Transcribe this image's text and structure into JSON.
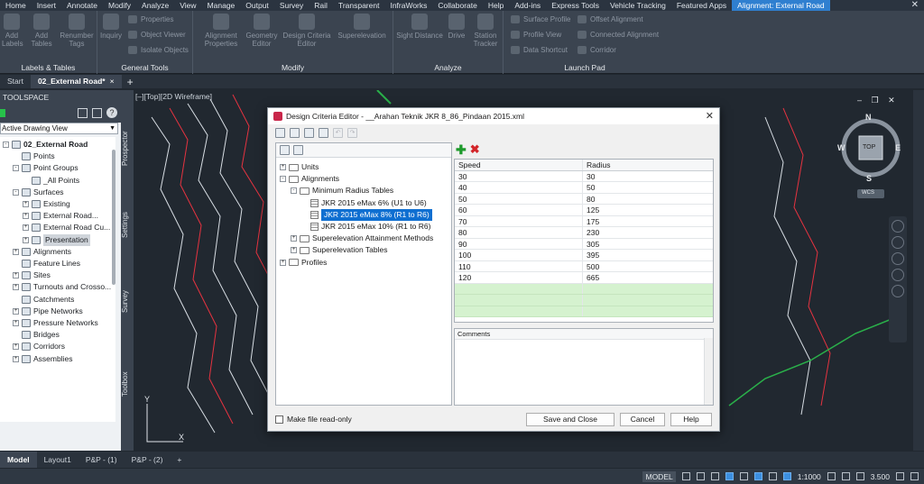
{
  "ribbon_tabs": [
    "Home",
    "Insert",
    "Annotate",
    "Modify",
    "Analyze",
    "View",
    "Manage",
    "Output",
    "Survey",
    "Rail",
    "Transparent",
    "InfraWorks",
    "Collaborate",
    "Help",
    "Add-ins",
    "Express Tools",
    "Vehicle Tracking",
    "Featured Apps",
    "Alignment: External Road"
  ],
  "ribbon": {
    "labels_tables": {
      "title": "Labels & Tables",
      "add_labels": "Add Labels",
      "add_tables": "Add Tables",
      "renumber_tags": "Renumber Tags"
    },
    "general_tools": {
      "title": "General Tools",
      "inquiry": "Inquiry",
      "properties": "Properties",
      "object_viewer": "Object Viewer",
      "isolate_objects": "Isolate Objects"
    },
    "modify": {
      "title": "Modify",
      "alignment_properties": "Alignment Properties",
      "geometry_editor": "Geometry Editor",
      "design_criteria_editor": "Design Criteria Editor",
      "superelevation": "Superelevation"
    },
    "analyze": {
      "title": "Analyze",
      "sight_distance": "Sight Distance",
      "drive": "Drive",
      "station_tracker": "Station Tracker"
    },
    "launch_pad": {
      "title": "Launch Pad",
      "surface_profile": "Surface Profile",
      "profile_view": "Profile View",
      "data_shortcut": "Data Shortcut",
      "offset_alignment": "Offset Alignment",
      "connected_alignment": "Connected Alignment",
      "corridor": "Corridor"
    }
  },
  "doc_tabs": {
    "start": "Start",
    "active": "02_External Road*",
    "close": "×",
    "plus": "+"
  },
  "toolspace": {
    "title": "TOOLSPACE",
    "view": "Active Drawing View",
    "tree": [
      {
        "label": "02_External Road",
        "level": 0,
        "exp": "-",
        "bold": true
      },
      {
        "label": "Points",
        "level": 1,
        "exp": ""
      },
      {
        "label": "Point Groups",
        "level": 1,
        "exp": "-"
      },
      {
        "label": "_All Points",
        "level": 2,
        "exp": ""
      },
      {
        "label": "Surfaces",
        "level": 1,
        "exp": "-"
      },
      {
        "label": "Existing",
        "level": 2,
        "exp": "+"
      },
      {
        "label": "External Road...",
        "level": 2,
        "exp": "+"
      },
      {
        "label": "External Road Cu...",
        "level": 2,
        "exp": "+"
      },
      {
        "label": "Presentation",
        "level": 2,
        "exp": "+",
        "sel": true
      },
      {
        "label": "Alignments",
        "level": 1,
        "exp": "+"
      },
      {
        "label": "Feature Lines",
        "level": 1,
        "exp": ""
      },
      {
        "label": "Sites",
        "level": 1,
        "exp": "+"
      },
      {
        "label": "Turnouts and Crosso...",
        "level": 1,
        "exp": "+"
      },
      {
        "label": "Catchments",
        "level": 1,
        "exp": ""
      },
      {
        "label": "Pipe Networks",
        "level": 1,
        "exp": "+"
      },
      {
        "label": "Pressure Networks",
        "level": 1,
        "exp": "+"
      },
      {
        "label": "Bridges",
        "level": 1,
        "exp": ""
      },
      {
        "label": "Corridors",
        "level": 1,
        "exp": "+"
      },
      {
        "label": "Assemblies",
        "level": 1,
        "exp": "+"
      }
    ],
    "side_tabs": [
      "Prospector",
      "Settings",
      "Survey",
      "Toolbox"
    ]
  },
  "viewport": {
    "label": "[–][Top][2D Wireframe]",
    "controls": "– ❐ ✕",
    "wcs": "WCS",
    "cube_top": "TOP",
    "compass": {
      "n": "N",
      "s": "S",
      "e": "E",
      "w": "W"
    }
  },
  "dialog": {
    "title": "Design Criteria Editor - __Arahan Teknik JKR 8_86_Pindaan 2015.xml",
    "close": "✕",
    "tree": [
      {
        "label": "Units",
        "level": 0,
        "exp": "+",
        "icon": "folder"
      },
      {
        "label": "Alignments",
        "level": 0,
        "exp": "-",
        "icon": "folder"
      },
      {
        "label": "Minimum Radius Tables",
        "level": 1,
        "exp": "-",
        "icon": "folder"
      },
      {
        "label": "JKR 2015 eMax 6% (U1 to U6)",
        "level": 2,
        "exp": "",
        "icon": "grid"
      },
      {
        "label": "JKR 2015 eMax 8% (R1 to R6)",
        "level": 2,
        "exp": "",
        "icon": "grid",
        "sel": true
      },
      {
        "label": "JKR 2015 eMax 10% (R1 to R6)",
        "level": 2,
        "exp": "",
        "icon": "grid"
      },
      {
        "label": "Superelevation Attainment Methods",
        "level": 1,
        "exp": "+",
        "icon": "folder"
      },
      {
        "label": "Superelevation Tables",
        "level": 1,
        "exp": "+",
        "icon": "folder"
      },
      {
        "label": "Profiles",
        "level": 0,
        "exp": "+",
        "icon": "folder"
      }
    ],
    "table": {
      "headers": [
        "Speed",
        "Radius"
      ],
      "rows": [
        [
          "30",
          "30"
        ],
        [
          "40",
          "50"
        ],
        [
          "50",
          "80"
        ],
        [
          "60",
          "125"
        ],
        [
          "70",
          "175"
        ],
        [
          "80",
          "230"
        ],
        [
          "90",
          "305"
        ],
        [
          "100",
          "395"
        ],
        [
          "110",
          "500"
        ],
        [
          "120",
          "665"
        ]
      ]
    },
    "comments_label": "Comments",
    "readonly_label": "Make file read-only",
    "buttons": {
      "save": "Save and Close",
      "cancel": "Cancel",
      "help": "Help"
    }
  },
  "layout_tabs": [
    "Model",
    "Layout1",
    "P&P - (1)",
    "P&P - (2)",
    "+"
  ],
  "status": {
    "model": "MODEL",
    "scale": "1:1000",
    "value": "3.500"
  },
  "colors": {
    "accent": "#2f7fd0",
    "selection": "#0f6fd1",
    "add": "#1d9a2b",
    "delete": "#d3262a",
    "new_row": "#d5f2cf"
  }
}
